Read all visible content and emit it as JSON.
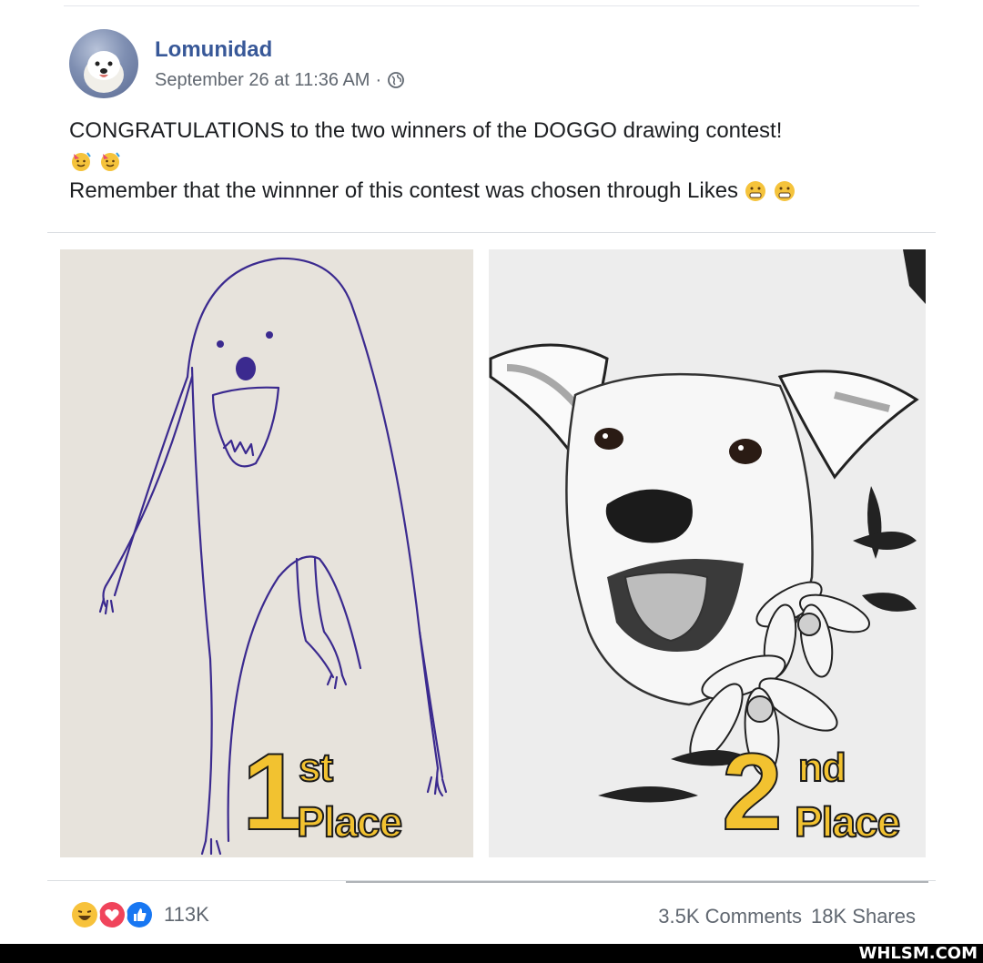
{
  "post": {
    "author": "Lomunidad",
    "timestamp": "September 26 at 11:36 AM",
    "separator": "·",
    "audience_icon": "globe-icon",
    "text_line1": "CONGRATULATIONS to the two winners of the DOGGO drawing contest!",
    "text_line3": "Remember that the winnner of this contest was chosen through Likes"
  },
  "images": {
    "left": {
      "place_number": "1",
      "place_suffix": "st",
      "place_word": "Place"
    },
    "right": {
      "place_number": "2",
      "place_suffix": "nd",
      "place_word": "Place"
    }
  },
  "footer": {
    "reaction_icons": [
      "haha-icon",
      "love-icon",
      "like-icon"
    ],
    "reaction_count": "113K",
    "comments": "3.5K Comments",
    "shares": "18K Shares"
  },
  "watermark": "WHLSM.COM",
  "colors": {
    "link": "#385898",
    "meta": "#606770",
    "place_gold": "#f2c230",
    "pen_blue": "#3b2a8f"
  }
}
